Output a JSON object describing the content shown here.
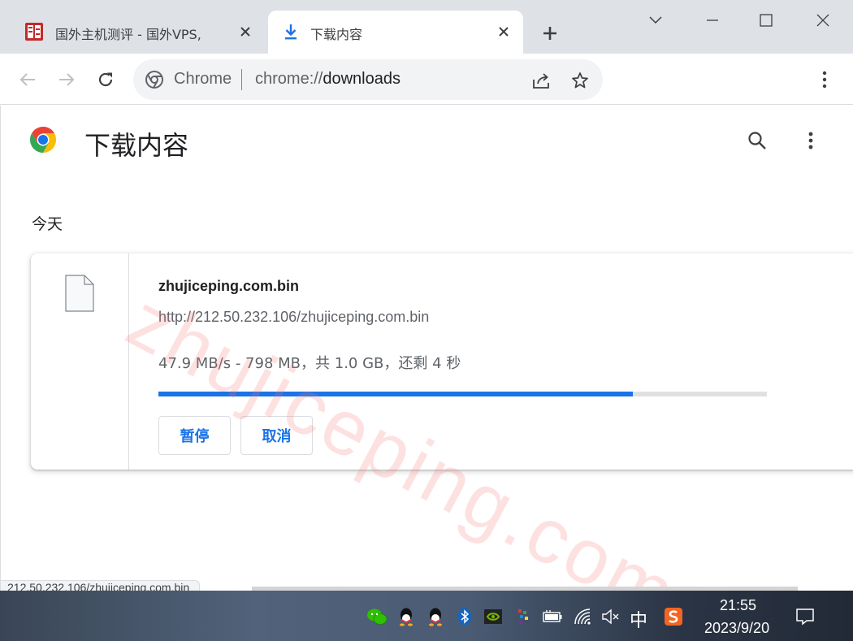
{
  "tabs": [
    {
      "title": "国外主机测评 - 国外VPS,",
      "icon": "site-favicon",
      "active": false
    },
    {
      "title": "下载内容",
      "icon": "download-icon",
      "active": true
    }
  ],
  "toolbar": {
    "site_chip": "Chrome",
    "url_scheme": "chrome://",
    "url_host": "downloads"
  },
  "page": {
    "title": "下载内容",
    "date_header": "今天"
  },
  "download": {
    "filename": "zhujiceping.com.bin",
    "url": "http://212.50.232.106/zhujiceping.com.bin",
    "status": "47.9 MB/s - 798 MB，共 1.0 GB，还剩 4 秒",
    "progress": 0.78,
    "pause_label": "暂停",
    "cancel_label": "取消"
  },
  "status_bubble": "212.50.232.106/zhujiceping.com.bin",
  "watermark": "zhujiceping.com",
  "taskbar": {
    "ime": "中",
    "time": "21:55",
    "date": "2023/9/20"
  },
  "colors": {
    "accent": "#1a73e8",
    "tabstrip": "#dee1e6",
    "progress_track": "#e0e0e0"
  }
}
